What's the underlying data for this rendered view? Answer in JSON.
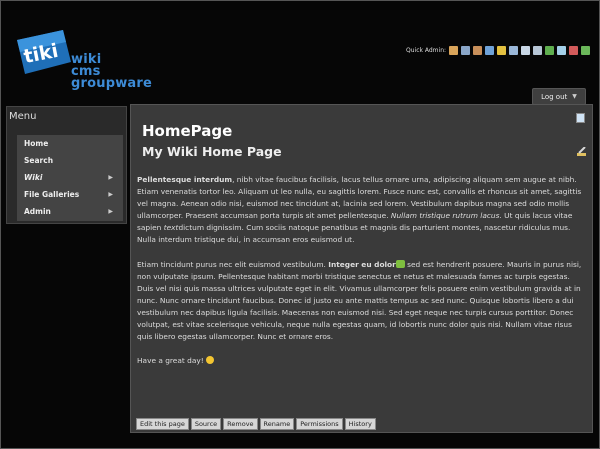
{
  "logo": {
    "badge_text": "tiki",
    "words": [
      "wiki",
      "cms",
      "groupware"
    ],
    "brand_color": "#2f7fc9"
  },
  "quick_admin": {
    "label": "Quick Admin:",
    "icons": [
      "home-icon",
      "tools-icon",
      "users-icon",
      "groups-icon",
      "key-icon",
      "modules-icon",
      "calendar-icon",
      "list-icon",
      "refresh-icon",
      "plugin-icon",
      "banner-icon",
      "gear-icon"
    ]
  },
  "logout": {
    "label": "Log out"
  },
  "menu": {
    "title": "Menu",
    "items": [
      {
        "label": "Home",
        "has_submenu": false,
        "italic": false
      },
      {
        "label": "Search",
        "has_submenu": false,
        "italic": false
      },
      {
        "label": "Wiki",
        "has_submenu": true,
        "italic": true
      },
      {
        "label": "File Galleries",
        "has_submenu": true,
        "italic": false
      },
      {
        "label": "Admin",
        "has_submenu": true,
        "italic": false
      }
    ]
  },
  "page": {
    "title": "HomePage",
    "subtitle": "My Wiki Home Page",
    "p1_bold": "Pellentesque interdum",
    "p1_a": ", nibh vitae faucibus facilisis, lacus tellus ornare urna, adipiscing aliquam sem augue at nibh. Etiam venenatis tortor leo. Aliquam ut leo nulla, eu sagittis lorem. Fusce nunc est, convallis et rhoncus sit amet, sagittis vel magna. Aenean odio nisi, euismod nec tincidunt at, lacinia sed lorem. Vestibulum dapibus magna sed odio mollis ullamcorper. Praesent accumsan porta turpis sit amet pellentesque. ",
    "p1_italic": "Nullam tristique rutrum lacus.",
    "p1_b": " Ut quis lacus vitae sapien ",
    "p1_italic2": "text",
    "p1_c": "dictum dignissim. Cum sociis natoque penatibus et magnis dis parturient montes, nascetur ridiculus mus. Nulla interdum tristique dui, in accumsan eros euismod ut.",
    "p2_a": "Etiam tincidunt purus nec elit euismod vestibulum. ",
    "p2_bold": "Integer eu dolor",
    "p2_b": " sed est hendrerit posuere. Mauris in purus nisi, non vulputate ipsum. Pellentesque habitant morbi tristique senectus et netus et malesuada fames ac turpis egestas. Duis vel nisi quis massa ultrices vulputate eget in elit. Vivamus ullamcorper felis posuere enim vestibulum gravida at in nunc. Nunc ornare tincidunt faucibus. Donec id justo eu ante mattis tempus ac sed nunc. Quisque lobortis libero a dui vestibulum nec dapibus ligula facilisis. Maecenas non euismod nisi. Sed eget neque nec turpis cursus porttitor. Donec volutpat, est vitae scelerisque vehicula, neque nulla egestas quam, id lobortis nunc dolor quis nisi. Nullam vitae risus quis libero egestas ullamcorper. Nunc et ornare eros.",
    "p3": "Have a great day!"
  },
  "actions": [
    "Edit this page",
    "Source",
    "Remove",
    "Rename",
    "Permissions",
    "History"
  ]
}
